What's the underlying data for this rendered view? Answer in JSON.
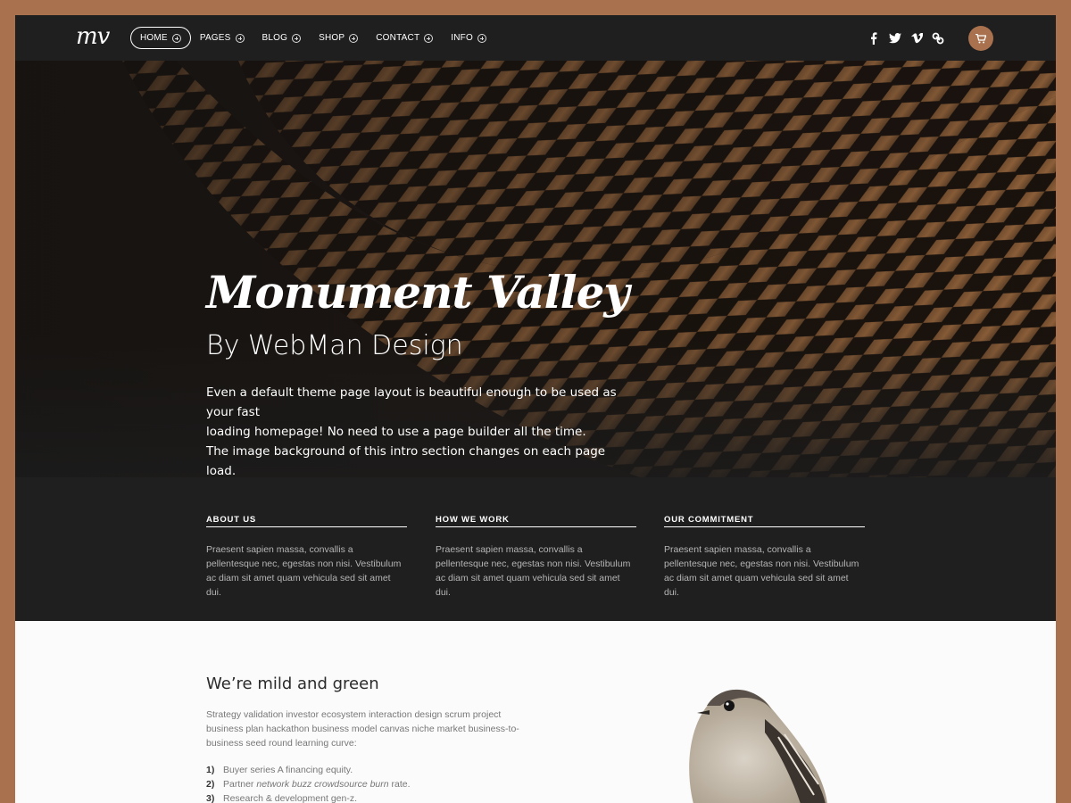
{
  "brand": {
    "logo_text": "mv"
  },
  "nav": {
    "items": [
      {
        "label": "HOME",
        "active": true
      },
      {
        "label": "PAGES"
      },
      {
        "label": "BLOG"
      },
      {
        "label": "SHOP"
      },
      {
        "label": "CONTACT"
      },
      {
        "label": "INFO"
      }
    ],
    "social_icons": [
      "facebook-icon",
      "twitter-icon",
      "vimeo-icon",
      "link-icon"
    ],
    "cart_icon": "cart-icon",
    "accent_color": "#a9714e"
  },
  "hero": {
    "title": "Monument Valley",
    "subtitle": "By WebMan Design",
    "text_line1": "Even a default theme page layout is beautiful enough to be used as your fast",
    "text_line2": "loading homepage! No need to use a page builder all the time.",
    "text_line3": "The image background of this intro section changes on each page load."
  },
  "features": [
    {
      "title": "ABOUT US",
      "text": "Praesent sapien massa, convallis a pellentesque nec, egestas non nisi. Vestibulum ac diam sit amet quam vehicula sed sit amet dui."
    },
    {
      "title": "HOW WE WORK",
      "text": "Praesent sapien massa, convallis a pellentesque nec, egestas non nisi. Vestibulum ac diam sit amet quam vehicula sed sit amet dui."
    },
    {
      "title": "OUR COMMITMENT",
      "text": "Praesent sapien massa, convallis a pellentesque nec, egestas non nisi. Vestibulum ac diam sit amet quam vehicula sed sit amet dui."
    }
  ],
  "content": {
    "heading": "We’re mild and green",
    "intro": "Strategy validation investor ecosystem interaction design scrum project business plan hackathon business model canvas niche market business-to-business seed round learning curve:",
    "list": [
      {
        "num": "1)",
        "pre": "Buyer series A financing equity.",
        "em": "",
        "post": ""
      },
      {
        "num": "2)",
        "pre": "Partner ",
        "em": "network buzz crowdsource burn",
        "post": " rate."
      },
      {
        "num": "3)",
        "pre": "Research & development gen-z.",
        "em": "",
        "post": ""
      }
    ]
  }
}
